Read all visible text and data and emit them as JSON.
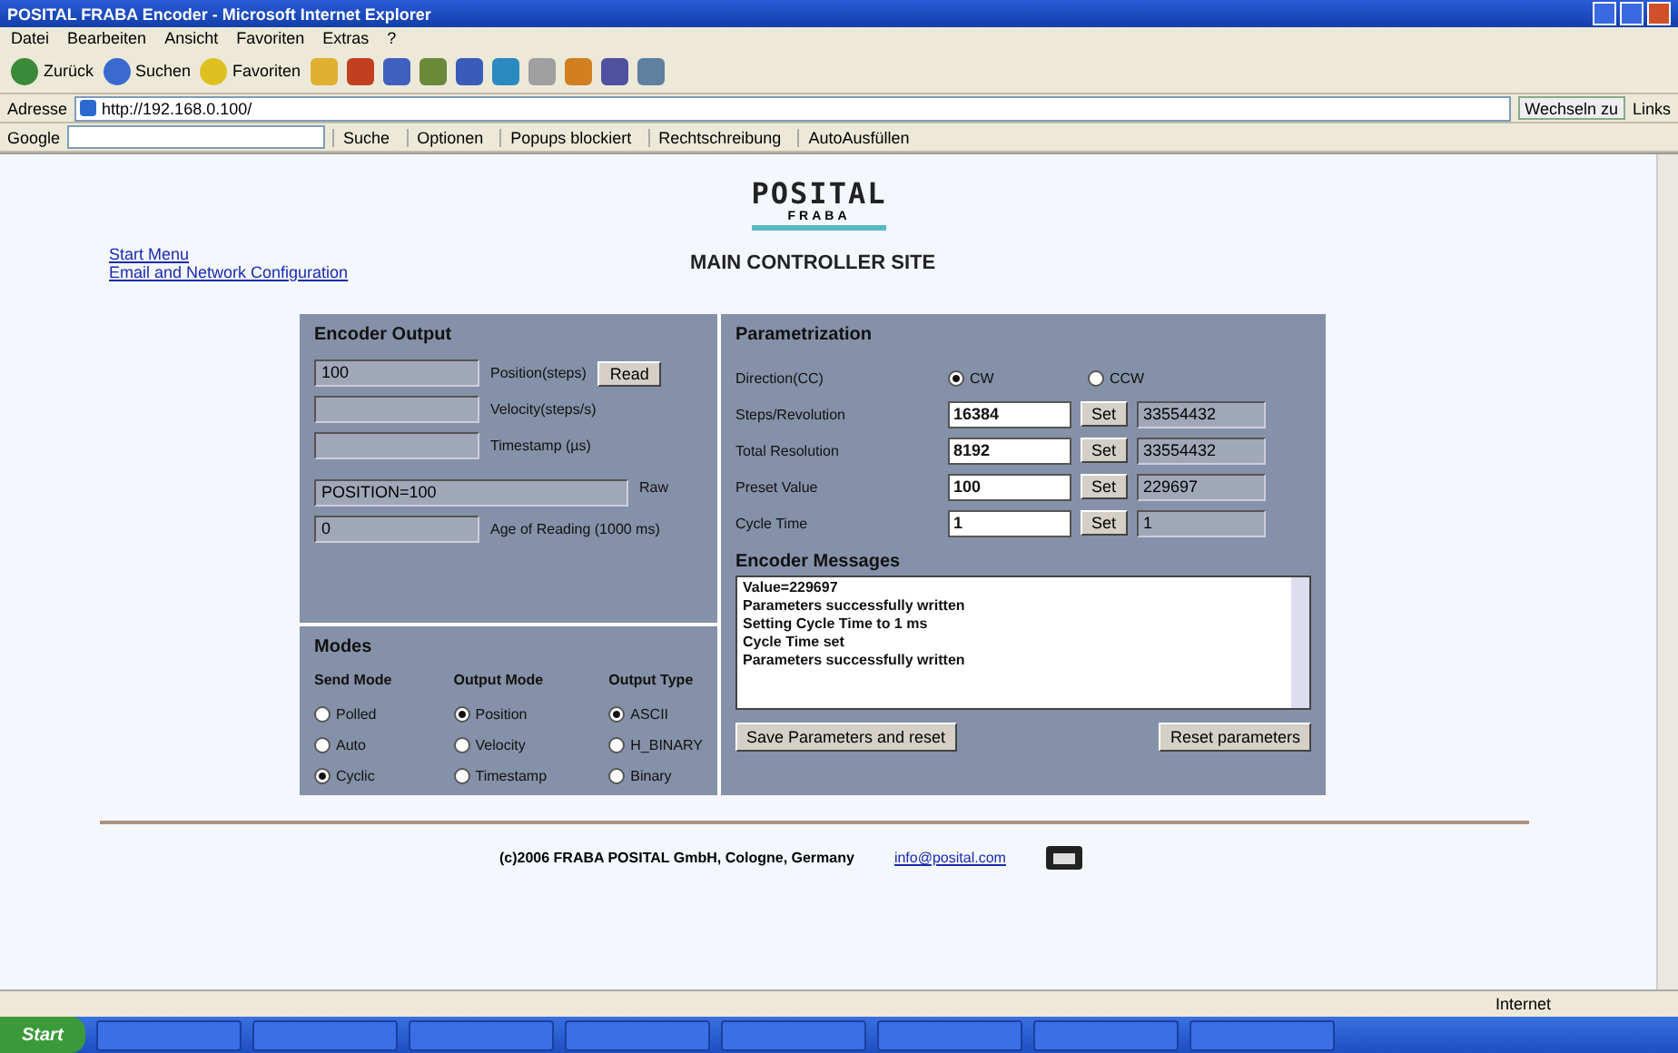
{
  "window": {
    "title": "POSITAL FRABA Encoder - Microsoft Internet Explorer"
  },
  "menu": [
    "Datei",
    "Bearbeiten",
    "Ansicht",
    "Favoriten",
    "Extras",
    "?"
  ],
  "toolbar": [
    {
      "label": "Zurück"
    },
    {
      "label": "Suchen"
    },
    {
      "label": "Favoriten"
    }
  ],
  "address": {
    "label": "Adresse",
    "value": "http://192.168.0.100/",
    "go": "Wechseln zu",
    "links": "Links"
  },
  "google_bar": {
    "label": "Google",
    "items": [
      "Suche",
      "Optionen",
      "Popups blockiert",
      "Rechtschreibung",
      "AutoAusfüllen"
    ]
  },
  "page": {
    "logo": {
      "name": "POSITAL",
      "sub": "FRABA"
    },
    "links": [
      "Start Menu",
      "Email and Network Configuration"
    ],
    "heading": "MAIN CONTROLLER SITE",
    "encoder_output": {
      "title": "Encoder Output",
      "rows": [
        {
          "kind": "field",
          "value": "100",
          "label": "Position(steps)",
          "button": "Read"
        },
        {
          "kind": "field",
          "label": "Velocity(steps/s)"
        },
        {
          "kind": "field",
          "label": "Timestamp (µs)"
        },
        {
          "kind": "wide",
          "value": "POSITION=100",
          "label": "Raw"
        },
        {
          "kind": "field",
          "value": "0",
          "label": "Age of Reading (1000 ms)"
        }
      ]
    },
    "modes": {
      "title": "Modes",
      "columns": [
        {
          "heading": "Send Mode",
          "options": [
            {
              "label": "Polled",
              "selected": false
            },
            {
              "label": "Auto",
              "selected": false
            },
            {
              "label": "Cyclic",
              "selected": true
            }
          ]
        },
        {
          "heading": "Output Mode",
          "options": [
            {
              "label": "Position",
              "selected": true
            },
            {
              "label": "Velocity",
              "selected": false
            },
            {
              "label": "Timestamp",
              "selected": false
            }
          ]
        },
        {
          "heading": "Output Type",
          "options": [
            {
              "label": "ASCII",
              "selected": true
            },
            {
              "label": "H_BINARY",
              "selected": false
            },
            {
              "label": "Binary",
              "selected": false
            }
          ]
        }
      ]
    },
    "parametrization": {
      "title": "Parametrization",
      "direction": {
        "label": "Direction(CC)",
        "options": [
          {
            "label": "CW",
            "selected": true
          },
          {
            "label": "CCW",
            "selected": false
          }
        ]
      },
      "rows": [
        {
          "label": "Steps/Revolution",
          "value": "16384",
          "button": "Set",
          "current": "33554432"
        },
        {
          "label": "Total Resolution",
          "value": "8192",
          "button": "Set",
          "current": "33554432"
        },
        {
          "label": "Preset Value",
          "value": "100",
          "button": "Set",
          "current": "229697"
        },
        {
          "label": "Cycle Time",
          "value": "1",
          "button": "Set",
          "current": "1"
        }
      ]
    },
    "messages": {
      "title": "Encoder Messages",
      "lines": [
        "Value=229697",
        "Parameters successfully written",
        "Setting Cycle Time to 1 ms",
        "Cycle Time set",
        "Parameters successfully written"
      ]
    },
    "buttons": [
      "Save Parameters and reset",
      "Reset parameters"
    ],
    "footer": {
      "text": "(c)2006 FRABA POSITAL GmbH, Cologne, Germany",
      "link": "info@posital.com"
    }
  },
  "status_bar": {
    "zone": "Internet"
  },
  "taskbar": {
    "start": "Start"
  }
}
